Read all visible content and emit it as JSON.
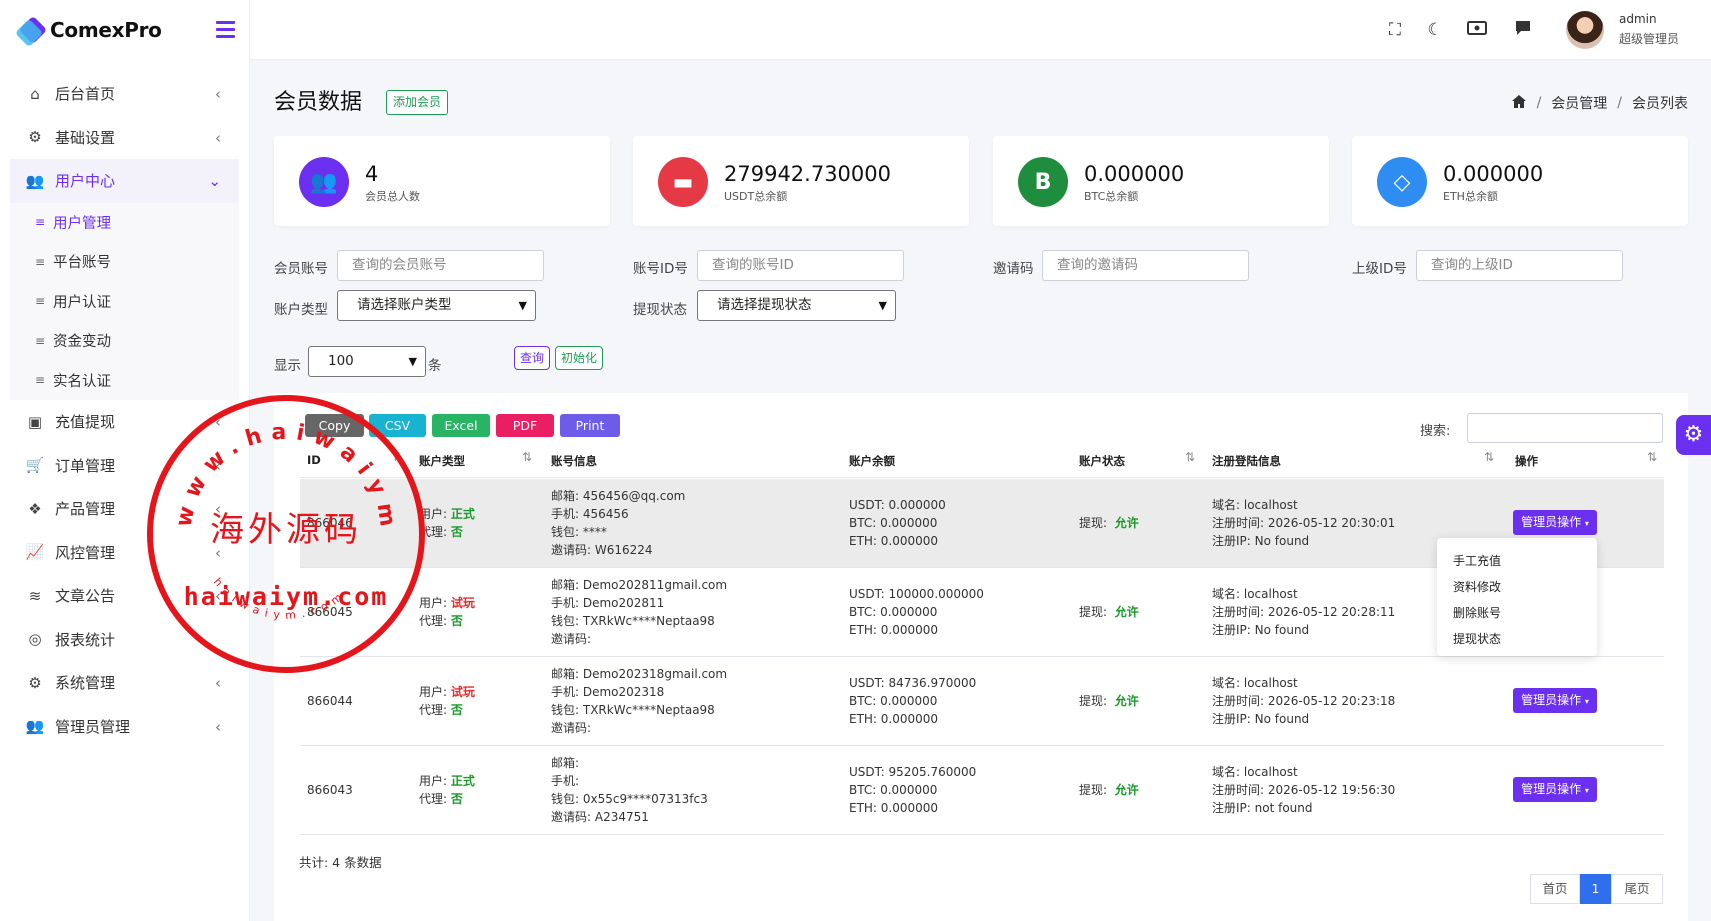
{
  "brand": "ComexPro",
  "sidebar": {
    "items": [
      {
        "label": "后台首页",
        "icon": "home-icon"
      },
      {
        "label": "基础设置",
        "icon": "cogs-icon"
      },
      {
        "label": "用户中心",
        "icon": "users-icon"
      },
      {
        "label": "充值提现",
        "icon": "money-icon"
      },
      {
        "label": "订单管理",
        "icon": "cart-icon"
      },
      {
        "label": "产品管理",
        "icon": "cubes-icon"
      },
      {
        "label": "风控管理",
        "icon": "chart-line-icon"
      },
      {
        "label": "文章公告",
        "icon": "layers-icon"
      },
      {
        "label": "报表统计",
        "icon": "coins-icon"
      },
      {
        "label": "系统管理",
        "icon": "gear-icon"
      },
      {
        "label": "管理员管理",
        "icon": "group-icon"
      }
    ],
    "submenu": [
      "用户管理",
      "平台账号",
      "用户认证",
      "资金变动",
      "实名认证"
    ]
  },
  "topbar": {
    "user": "admin",
    "role": "超级管理员"
  },
  "page": {
    "title": "会员数据",
    "add_button": "添加会员",
    "breadcrumb": [
      "会员管理",
      "会员列表"
    ]
  },
  "stats": [
    {
      "value": "4",
      "label": "会员总人数",
      "color": "#6b2ff0",
      "icon": "users-icon"
    },
    {
      "value": "279942.730000",
      "label": "USDT总余额",
      "color": "#e53946",
      "icon": "wallet-icon"
    },
    {
      "value": "0.000000",
      "label": "BTC总余额",
      "color": "#1e8e3e",
      "icon": "bitcoin-icon"
    },
    {
      "value": "0.000000",
      "label": "ETH总余额",
      "color": "#2f8cf0",
      "icon": "diamond-icon"
    }
  ],
  "filters": {
    "account_label": "会员账号",
    "account_ph": "查询的会员账号",
    "id_label": "账号ID号",
    "id_ph": "查询的账号ID",
    "invite_label": "邀请码",
    "invite_ph": "查询的邀请码",
    "parent_label": "上级ID号",
    "parent_ph": "查询的上级ID",
    "type_label": "账户类型",
    "type_value": "请选择账户类型",
    "withdraw_label": "提现状态",
    "withdraw_value": "请选择提现状态",
    "show_label": "显示",
    "show_value": "100",
    "show_unit": "条",
    "query": "查询",
    "reset": "初始化"
  },
  "export": [
    "Copy",
    "CSV",
    "Excel",
    "PDF",
    "Print"
  ],
  "search_label": "搜索:",
  "table": {
    "headers": [
      "ID",
      "账户类型",
      "账号信息",
      "账户余额",
      "账户状态",
      "注册登陆信息",
      "操作"
    ],
    "rows": [
      {
        "id": "866046",
        "user_l": "用户:",
        "user_v": "正式",
        "agent_l": "代理:",
        "agent_v": "否",
        "account": "邮箱: 456456@qq.com\n手机: 456456\n钱包: ****\n邀请码: W616224",
        "balance": "USDT: 0.000000\nBTC: 0.000000\nETH: 0.000000",
        "status_l": "提现:",
        "status_v": "允许",
        "reg": "域名: localhost\n注册时间: 2026-05-12 20:30:01\n注册IP: No found",
        "action": "管理员操作"
      },
      {
        "id": "866045",
        "user_l": "用户:",
        "user_v": "试玩",
        "agent_l": "代理:",
        "agent_v": "否",
        "account": "邮箱: Demo202811gmail.com\n手机: Demo202811\n钱包: TXRkWc****Neptaa98\n邀请码:",
        "balance": "USDT: 100000.000000\nBTC: 0.000000\nETH: 0.000000",
        "status_l": "提现:",
        "status_v": "允许",
        "reg": "域名: localhost\n注册时间: 2026-05-12 20:28:11\n注册IP: No found",
        "action": "管理员操作"
      },
      {
        "id": "866044",
        "user_l": "用户:",
        "user_v": "试玩",
        "agent_l": "代理:",
        "agent_v": "否",
        "account": "邮箱: Demo202318gmail.com\n手机: Demo202318\n钱包: TXRkWc****Neptaa98\n邀请码:",
        "balance": "USDT: 84736.970000\nBTC: 0.000000\nETH: 0.000000",
        "status_l": "提现:",
        "status_v": "允许",
        "reg": "域名: localhost\n注册时间: 2026-05-12 20:23:18\n注册IP: No found",
        "action": "管理员操作"
      },
      {
        "id": "866043",
        "user_l": "用户:",
        "user_v": "正式",
        "agent_l": "代理:",
        "agent_v": "否",
        "account": "邮箱:\n手机:\n钱包: 0x55c9****07313fc3\n邀请码: A234751",
        "balance": "USDT: 95205.760000\nBTC: 0.000000\nETH: 0.000000",
        "status_l": "提现:",
        "status_v": "允许",
        "reg": "域名: localhost\n注册时间: 2026-05-12 19:56:30\n注册IP: not found",
        "action": "管理员操作"
      }
    ]
  },
  "dropdown": [
    "手工充值",
    "资料修改",
    "删除账号",
    "提现状态"
  ],
  "footer": {
    "total": "共计: 4 条数据",
    "first": "首页",
    "current": "1",
    "last": "尾页"
  },
  "watermark": {
    "cn": "海外源码",
    "top": "www.haiwaiym.com",
    "mid": "haiwaiym.com",
    "bottom": "haiwaiym.com"
  }
}
